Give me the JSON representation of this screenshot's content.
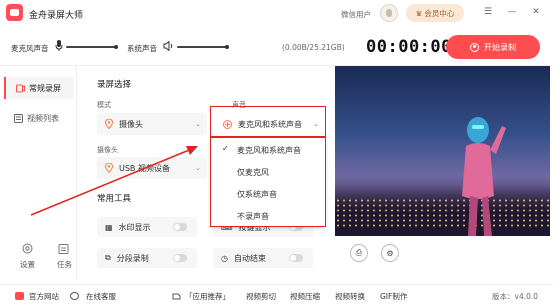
{
  "app": {
    "title": "金舟录屏大师",
    "wechat_user": "微信用户",
    "member_center": "会员中心"
  },
  "controls": {
    "mic_label": "麦克风声音",
    "system_label": "系统声音",
    "storage": "(0.00B/25.21GB)",
    "timer": "00:00:00",
    "record_label": "开始录制"
  },
  "sidebar": {
    "items": [
      {
        "label": "常规录屏"
      },
      {
        "label": "视频列表"
      }
    ],
    "settings": "设置",
    "tasks": "任务"
  },
  "main": {
    "section_record": "录屏选择",
    "mode_label": "模式",
    "mode_value": "摄像头",
    "audio_label": "声音",
    "audio_value": "麦克风和系统声音",
    "camera_label": "摄像头",
    "camera_value": "USB 视频设备",
    "tools_title": "常用工具",
    "tools": [
      {
        "label": "水印显示"
      },
      {
        "label": "按键显示"
      },
      {
        "label": "分段录制"
      },
      {
        "label": "自动结束"
      }
    ]
  },
  "dropdown": {
    "options": [
      "麦克风和系统声音",
      "仅麦克风",
      "仅系统声音",
      "不录声音"
    ],
    "selected": "麦克风和系统声音"
  },
  "bottom": {
    "website": "官方网站",
    "support": "在线客服",
    "links": [
      "「应用推荐」",
      "视频剪切",
      "视频压缩",
      "视频转换",
      "GIF制作"
    ],
    "version": "版本：v4.0.0"
  },
  "colors": {
    "accent": "#ff4d4f",
    "highlight": "#e32222"
  }
}
